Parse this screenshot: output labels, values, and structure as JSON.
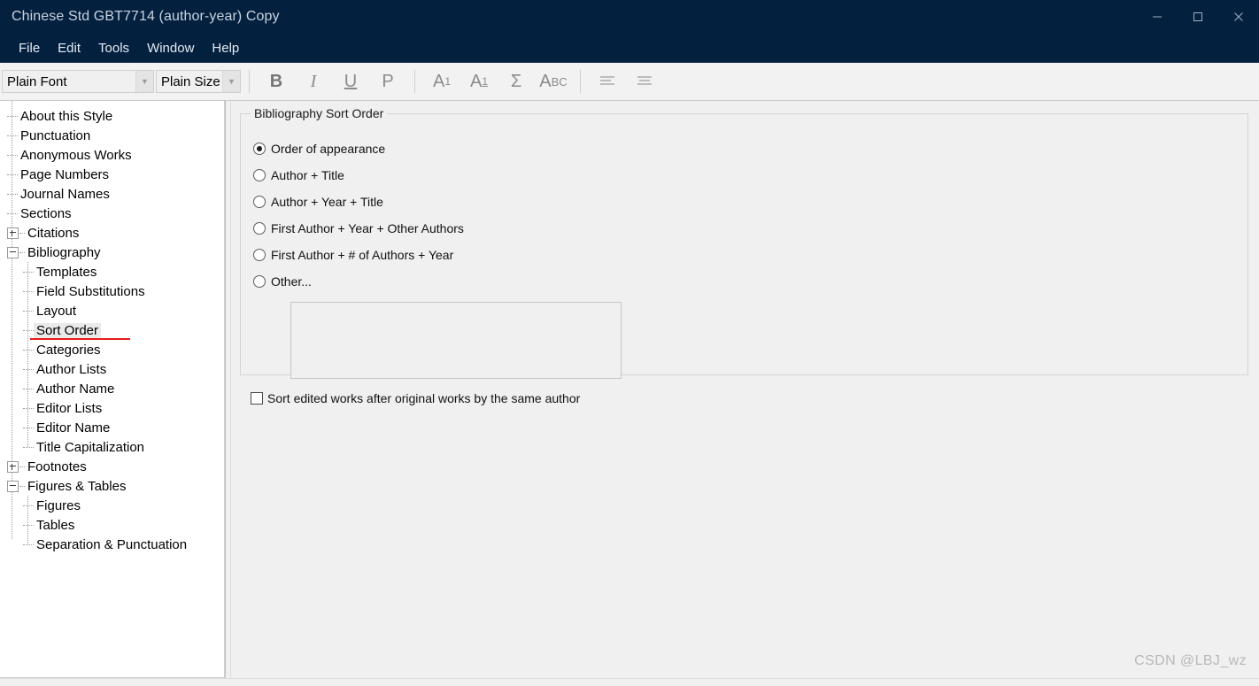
{
  "window": {
    "title": "Chinese Std GBT7714 (author-year) Copy",
    "controls": [
      {
        "name": "minimize",
        "glyph": "minimize-icon"
      },
      {
        "name": "maximize",
        "glyph": "maximize-icon"
      },
      {
        "name": "close",
        "glyph": "close-icon"
      }
    ],
    "titlebar_color": "#04203f",
    "accent_color": "#e81b1b"
  },
  "menubar": {
    "items": [
      {
        "label": "File"
      },
      {
        "label": "Edit"
      },
      {
        "label": "Tools"
      },
      {
        "label": "Window"
      },
      {
        "label": "Help"
      }
    ]
  },
  "toolbar": {
    "font_combo": {
      "value": "Plain Font",
      "placeholder": "Plain Font",
      "icon": "chevron-down-icon"
    },
    "size_combo": {
      "value": "Plain Size",
      "placeholder": "Plain Size",
      "icon": "chevron-down-icon"
    },
    "buttons": [
      {
        "label": "B",
        "name": "bold-button"
      },
      {
        "label": "I",
        "name": "italic-button"
      },
      {
        "label": "U",
        "name": "underline-button"
      },
      {
        "label": "P",
        "name": "plain-button"
      }
    ],
    "script_buttons": [
      {
        "base": "A",
        "script": "1",
        "name": "superscript-button"
      },
      {
        "base": "A",
        "script": "1",
        "name": "subscript-button"
      },
      {
        "label": "Σ",
        "name": "sigma-button"
      },
      {
        "base": "A",
        "rest": "BC",
        "name": "small-caps-button"
      }
    ],
    "align_buttons": [
      {
        "name": "align-left-button"
      },
      {
        "name": "align-center-button"
      }
    ]
  },
  "tree": {
    "items": [
      {
        "label": "About this Style",
        "depth": 1,
        "expander": "none",
        "selected": false
      },
      {
        "label": "Punctuation",
        "depth": 1,
        "expander": "none",
        "selected": false
      },
      {
        "label": "Anonymous Works",
        "depth": 1,
        "expander": "none",
        "selected": false
      },
      {
        "label": "Page Numbers",
        "depth": 1,
        "expander": "none",
        "selected": false
      },
      {
        "label": "Journal Names",
        "depth": 1,
        "expander": "none",
        "selected": false
      },
      {
        "label": "Sections",
        "depth": 1,
        "expander": "none",
        "selected": false
      },
      {
        "label": "Citations",
        "depth": 1,
        "expander": "plus",
        "selected": false
      },
      {
        "label": "Bibliography",
        "depth": 1,
        "expander": "minus",
        "selected": false
      },
      {
        "label": "Templates",
        "depth": 2,
        "expander": "none",
        "selected": false
      },
      {
        "label": "Field Substitutions",
        "depth": 2,
        "expander": "none",
        "selected": false
      },
      {
        "label": "Layout",
        "depth": 2,
        "expander": "none",
        "selected": false
      },
      {
        "label": "Sort Order",
        "depth": 2,
        "expander": "none",
        "selected": true
      },
      {
        "label": "Categories",
        "depth": 2,
        "expander": "none",
        "selected": false
      },
      {
        "label": "Author Lists",
        "depth": 2,
        "expander": "none",
        "selected": false
      },
      {
        "label": "Author Name",
        "depth": 2,
        "expander": "none",
        "selected": false
      },
      {
        "label": "Editor Lists",
        "depth": 2,
        "expander": "none",
        "selected": false
      },
      {
        "label": "Editor Name",
        "depth": 2,
        "expander": "none",
        "selected": false
      },
      {
        "label": "Title Capitalization",
        "depth": 2,
        "expander": "none",
        "selected": false
      },
      {
        "label": "Footnotes",
        "depth": 1,
        "expander": "plus",
        "selected": false
      },
      {
        "label": "Figures & Tables",
        "depth": 1,
        "expander": "minus",
        "selected": false
      },
      {
        "label": "Figures",
        "depth": 2,
        "expander": "none",
        "selected": false
      },
      {
        "label": "Tables",
        "depth": 2,
        "expander": "none",
        "selected": false
      },
      {
        "label": "Separation & Punctuation",
        "depth": 2,
        "expander": "none",
        "selected": false
      }
    ]
  },
  "main": {
    "groupbox_title": "Bibliography Sort Order",
    "radios": [
      {
        "label": "Order of appearance",
        "checked": true
      },
      {
        "label": "Author + Title",
        "checked": false
      },
      {
        "label": "Author + Year + Title",
        "checked": false
      },
      {
        "label": "First Author + Year + Other Authors",
        "checked": false
      },
      {
        "label": "First Author + # of Authors + Year",
        "checked": false
      },
      {
        "label": "Other...",
        "checked": false
      }
    ],
    "other_textarea": {
      "value": "",
      "placeholder": ""
    },
    "checkbox": {
      "label": "Sort edited works after original works by the same author",
      "checked": false
    }
  },
  "watermark": {
    "text": "CSDN @LBJ_wz"
  }
}
